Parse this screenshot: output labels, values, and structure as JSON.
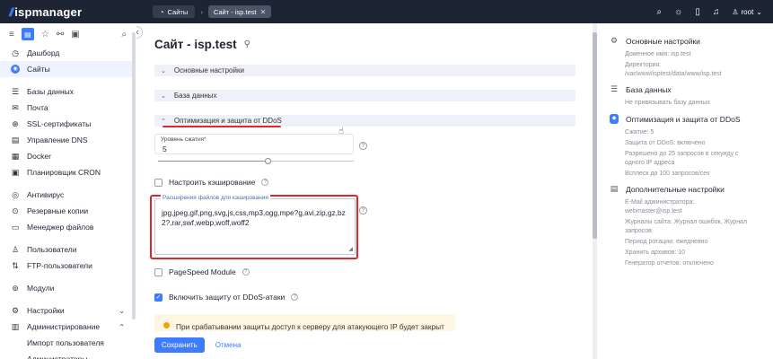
{
  "app": {
    "logo_text": "ispmanager",
    "logo_mark": "//"
  },
  "topbar": {
    "home_crumb": "Сайты",
    "active_crumb": "Сайт - isp.test",
    "user": "root"
  },
  "sidebar": {
    "items": [
      {
        "label": "Дашборд",
        "icon": "dashboard-icon",
        "glyph": "◷"
      },
      {
        "label": "Сайты",
        "icon": "globe-icon",
        "glyph": "◉",
        "active": true
      },
      {
        "label": "Базы данных",
        "icon": "database-icon",
        "glyph": "☰"
      },
      {
        "label": "Почта",
        "icon": "mail-icon",
        "glyph": "✉"
      },
      {
        "label": "SSL-сертификаты",
        "icon": "lock-icon",
        "glyph": "⊕"
      },
      {
        "label": "Управление DNS",
        "icon": "dns-icon",
        "glyph": "▤"
      },
      {
        "label": "Docker",
        "icon": "docker-icon",
        "glyph": "▦"
      },
      {
        "label": "Планировщик CRON",
        "icon": "calendar-icon",
        "glyph": "▣"
      },
      {
        "label": "Антивирус",
        "icon": "shield-icon",
        "glyph": "◎"
      },
      {
        "label": "Резервные копии",
        "icon": "backup-icon",
        "glyph": "⊙"
      },
      {
        "label": "Менеджер файлов",
        "icon": "folder-icon",
        "glyph": "▭"
      },
      {
        "label": "Пользователи",
        "icon": "user-icon",
        "glyph": "♙"
      },
      {
        "label": "FTP-пользователи",
        "icon": "ftp-icon",
        "glyph": "⇅"
      },
      {
        "label": "Модули",
        "icon": "modules-icon",
        "glyph": "⊚"
      },
      {
        "label": "Настройки",
        "icon": "settings-icon",
        "glyph": "⚙",
        "chevron": "⌄"
      },
      {
        "label": "Администрирование",
        "icon": "admin-icon",
        "glyph": "▥",
        "chevron": "⌃"
      }
    ],
    "sub_items": [
      "Импорт пользователя",
      "Администраторы"
    ]
  },
  "main": {
    "title": "Сайт - isp.test",
    "sections": [
      {
        "label": "Основные настройки",
        "expanded": false
      },
      {
        "label": "База данных",
        "expanded": false
      },
      {
        "label": "Оптимизация и защита от DDoS",
        "expanded": true
      }
    ],
    "compression": {
      "label": "Уровень сжатия",
      "required_mark": "*",
      "value": "5",
      "slider_fraction": 0.56
    },
    "cache_checkbox": {
      "label": "Настроить кэширование",
      "checked": false
    },
    "extensions": {
      "label": "Расширения файлов для кэширования",
      "value": "jpg,jpeg,gif,png,svg,js,css,mp3,ogg,mpe?g,avi,zip,gz,bz2?,rar,swf,webp,woff,woff2"
    },
    "pagespeed_checkbox": {
      "label": "PageSpeed Module",
      "checked": false
    },
    "ddos_checkbox": {
      "label": "Включить защиту от DDoS-атаки",
      "checked": true
    },
    "warning_text": "При срабатывании защиты доступ к серверу для атакующего IP будет закрыт",
    "save_label": "Сохранить",
    "cancel_label": "Отмена"
  },
  "right_panel": {
    "sections": [
      {
        "title": "Основные настройки",
        "lines": [
          "Доменное имя: isp.test",
          "Директория:",
          "/var/www/isptest/data/www/isp.test"
        ]
      },
      {
        "title": "База данных",
        "lines": [
          "Не привязывать базу данных"
        ]
      },
      {
        "title": "Оптимизация и защита от DDoS",
        "lines": [
          "Сжатие: 5",
          "Защита от DDoS: включено",
          "Разрешено до 25 запросов в секунду с",
          "одного IP адреса",
          "Всплеск до 100 запросов/сек"
        ]
      },
      {
        "title": "Дополнительные настройки",
        "lines": [
          "E-Mail администратора:",
          "webmaster@isp.test",
          "Журналы сайта: Журнал ошибок, Журнал",
          "запросов",
          "Период ротации: ежедневно",
          "Хранить архивов: 10",
          "Генератор отчетов: отключено"
        ]
      }
    ]
  },
  "colors": {
    "accent": "#3d7bff",
    "topbar": "#1d2433",
    "highlight": "#e0262b"
  }
}
